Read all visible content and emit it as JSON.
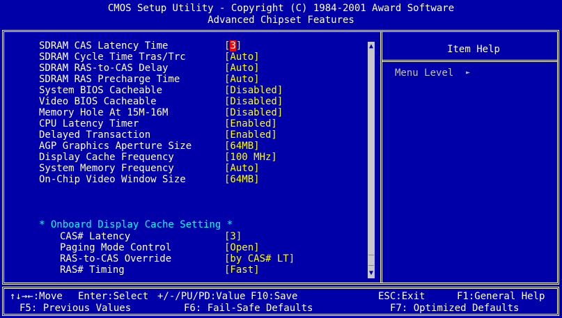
{
  "header": {
    "title": "CMOS Setup Utility - Copyright (C) 1984-2001 Award Software",
    "subtitle": "Advanced Chipset Features"
  },
  "settings": [
    {
      "label": "SDRAM CAS Latency Time",
      "value_open": "[",
      "value_hl": "3",
      "value_close": "]"
    },
    {
      "label": "SDRAM Cycle Time Tras/Trc",
      "value": "[Auto]"
    },
    {
      "label": "SDRAM RAS-to-CAS Delay",
      "value": "[Auto]"
    },
    {
      "label": "SDRAM RAS Precharge Time",
      "value": "[Auto]"
    },
    {
      "label": "System BIOS Cacheable",
      "value": "[Disabled]"
    },
    {
      "label": "Video BIOS Cacheable",
      "value": "[Disabled]"
    },
    {
      "label": "Memory Hole At 15M-16M",
      "value": "[Disabled]"
    },
    {
      "label": "CPU Latency Timer",
      "value": "[Enabled]"
    },
    {
      "label": "Delayed Transaction",
      "value": "[Enabled]"
    },
    {
      "label": "AGP Graphics Aperture Size",
      "value": "[64MB]"
    },
    {
      "label": "Display Cache Frequency",
      "value": "[100 MHz]"
    },
    {
      "label": "System Memory Frequency",
      "value": "[Auto]"
    },
    {
      "label": "On-Chip Video Window Size",
      "value": "[64MB]"
    }
  ],
  "section": {
    "title": "* Onboard Display Cache Setting *",
    "items": [
      {
        "label": "CAS# Latency",
        "value": "[3]"
      },
      {
        "label": "Paging Mode Control",
        "value": "[Open]"
      },
      {
        "label": "RAS-to-CAS Override",
        "value": "[by CAS# LT]"
      },
      {
        "label": "RAS# Timing",
        "value": "[Fast]"
      }
    ]
  },
  "help": {
    "title": "Item Help",
    "menu_level": "Menu Level",
    "arrow": "►"
  },
  "scrollbar": {
    "up": "▲",
    "down": "▼"
  },
  "footer": {
    "move": "↑↓→←:Move",
    "enter": "Enter:Select",
    "value": "+/-/PU/PD:Value",
    "save": "F10:Save",
    "esc": "ESC:Exit",
    "help": "F1:General Help",
    "prev": "F5: Previous Values",
    "failsafe": "F6: Fail-Safe Defaults",
    "optimized": "F7: Optimized Defaults"
  },
  "colors": {
    "background": "#0000a8",
    "value": "#ffff00",
    "section": "#00ffff",
    "highlight": "#ff0000"
  }
}
